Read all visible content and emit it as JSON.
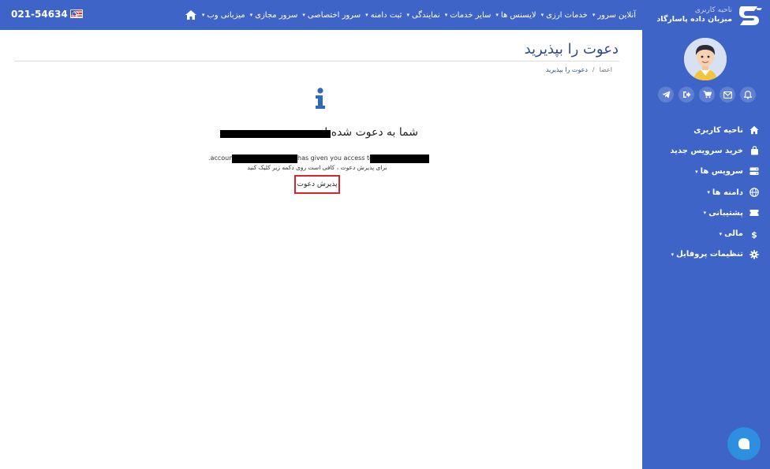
{
  "topbar": {
    "phone": "021-54634",
    "menu": [
      {
        "label": "میزبانی وب",
        "has_caret": true
      },
      {
        "label": "سرور مجازی",
        "has_caret": true
      },
      {
        "label": "سرور اختصاصی",
        "has_caret": true
      },
      {
        "label": "ثبت دامنه",
        "has_caret": true
      },
      {
        "label": "نمایندگی",
        "has_caret": true
      },
      {
        "label": "سایر خدمات",
        "has_caret": true
      },
      {
        "label": "لایسنس ها",
        "has_caret": true
      },
      {
        "label": "خدمات ارزی",
        "has_caret": true
      },
      {
        "label": "آنلاین سرور",
        "has_caret": true
      }
    ]
  },
  "sidebar": {
    "brand_sub": "ناحیه کاربری",
    "brand_name": "میزبان داده پاسارگاد",
    "nav": [
      {
        "label": "ناحیه کاربری",
        "icon": "home-icon",
        "caret": false
      },
      {
        "label": "خرید سرویس جدید",
        "icon": "bag-icon",
        "caret": false
      },
      {
        "label": "سرویس ها",
        "icon": "server-icon",
        "caret": true
      },
      {
        "label": "دامنه ها",
        "icon": "globe-icon",
        "caret": true
      },
      {
        "label": "پشتیبانی",
        "icon": "ticket-icon",
        "caret": true
      },
      {
        "label": "مالی",
        "icon": "dollar-icon",
        "caret": true
      },
      {
        "label": "تنظیمات پروفایل",
        "icon": "gear-icon",
        "caret": true
      }
    ]
  },
  "main": {
    "title": "دعوت را بپذیرید",
    "breadcrumb": {
      "first": "اعضا",
      "separator": "/",
      "current": "دعوت را بپذیرید"
    },
    "heading": "شما به دعوت شده اید",
    "line1_prefix": ".account",
    "line1_mid": "has given you access to the",
    "line2": "برای پذیرش دعوت ، کافی است روی دکمه زیر کلیک کنید",
    "accept_button": "پذیرش دعوت"
  },
  "colors": {
    "brand_blue": "#3f64c8",
    "title_blue": "#2d4a8a",
    "button_border": "#d9232d",
    "chat_blue": "#2e8fe0"
  }
}
